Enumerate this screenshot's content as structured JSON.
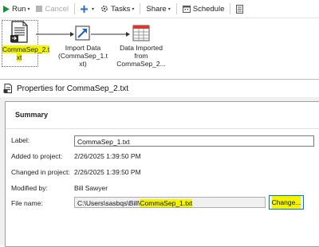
{
  "toolbar": {
    "run": "Run",
    "cancel": "Cancel",
    "tasks": "Tasks",
    "share": "Share",
    "schedule": "Schedule"
  },
  "flow": {
    "nodes": [
      {
        "label_line1": "CommaSep_2.t",
        "label_line2": "xt",
        "icon": "text-file-icon"
      },
      {
        "label_line1": "Import Data",
        "label_line2": "(CommaSep_1.t",
        "label_line3": "xt)",
        "icon": "import-data-icon"
      },
      {
        "label_line1": "Data Imported",
        "label_line2": "from",
        "label_line3": "CommaSep_2...",
        "icon": "dataset-table-icon"
      }
    ]
  },
  "dialog": {
    "title": "Properties for CommaSep_2.txt",
    "section": "Summary",
    "fields": {
      "label_caption": "Label:",
      "label_value": "CommaSep_1.txt",
      "added_caption": "Added to project:",
      "added_value": "2/26/2025 1:39:50 PM",
      "changed_caption": "Changed in project:",
      "changed_value": "2/26/2025 1:39:50 PM",
      "modified_caption": "Modified by:",
      "modified_value": "Bill Sawyer",
      "filename_caption": "File name:",
      "filename_path": "C:\\Users\\sasbqs\\Bill\\",
      "filename_file": "CommaSep_1.txt",
      "change_button": "Change..."
    }
  },
  "colors": {
    "highlight": "#f3f500",
    "accent": "#0078d7",
    "run_green": "#1a8f3c",
    "add_blue": "#2b6cc4"
  }
}
